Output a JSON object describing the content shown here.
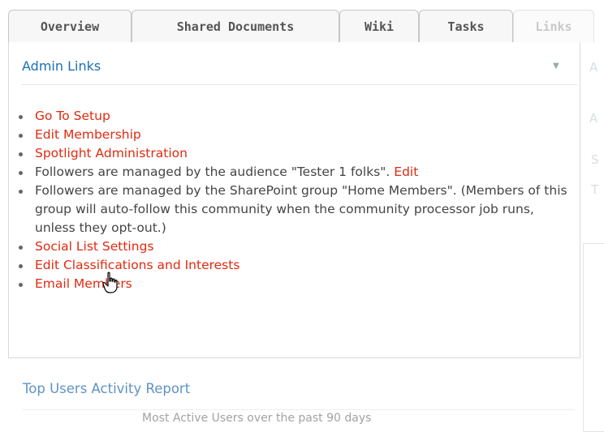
{
  "tabs": [
    {
      "label": "Overview"
    },
    {
      "label": "Shared Documents"
    },
    {
      "label": "Wiki"
    },
    {
      "label": "Tasks"
    },
    {
      "label": "Links"
    }
  ],
  "panel": {
    "title": "Admin Links",
    "items": [
      {
        "text": "Go To Setup"
      },
      {
        "text": "Edit Membership"
      },
      {
        "text": "Spotlight Administration"
      },
      {
        "text": "Followers are managed by the audience \"Tester 1 folks\".",
        "link": "Edit"
      },
      {
        "text": "Followers are managed by the SharePoint group \"Home Members\". (Members of this group will auto-follow this community when the community processor job runs, unless they opt-out.)"
      },
      {
        "text": "Social List Settings"
      },
      {
        "text": "Edit Classifications and Interests"
      },
      {
        "text": "Email Members"
      }
    ]
  },
  "side_ghost": [
    "A",
    "A",
    "S",
    "T"
  ],
  "report": {
    "title": "Top Users Activity Report",
    "subtitle": "Most Active Users over the past 90 days"
  },
  "colors": {
    "link": "#e02a10",
    "heading": "#1c6fb5"
  }
}
